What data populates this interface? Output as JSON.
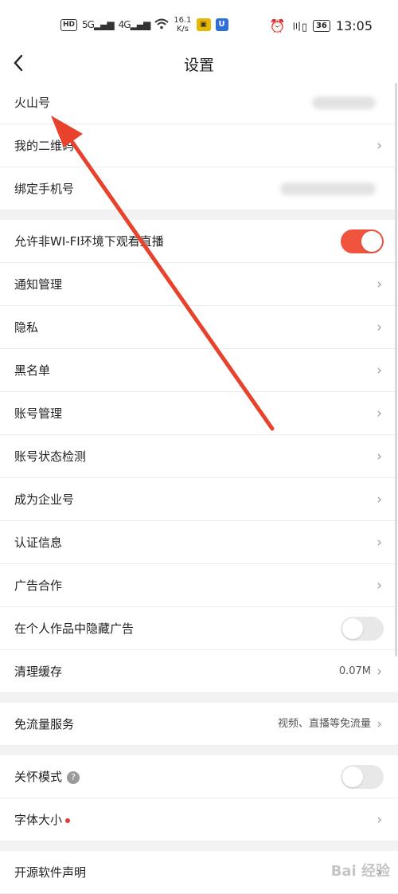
{
  "status_bar": {
    "hd": "HD",
    "sim1": "5G",
    "sim2": "4G",
    "speed_value": "16.1",
    "speed_unit": "K/s",
    "battery": "36",
    "time": "13:05"
  },
  "header": {
    "title": "设置"
  },
  "settings": {
    "huoshan_id": "火山号",
    "qr_code": "我的二维码",
    "bind_phone": "绑定手机号",
    "allow_non_wifi": "允许非WI-FI环境下观看直播",
    "allow_non_wifi_on": true,
    "notifications": "通知管理",
    "privacy": "隐私",
    "blacklist": "黑名单",
    "account_mgmt": "账号管理",
    "account_check": "账号状态检测",
    "enterprise": "成为企业号",
    "certification": "认证信息",
    "ad_coop": "广告合作",
    "hide_ads": "在个人作品中隐藏广告",
    "hide_ads_on": false,
    "clear_cache": "清理缓存",
    "cache_size": "0.07M",
    "free_data": "免流量服务",
    "free_data_desc": "视频、直播等免流量",
    "care_mode": "关怀模式",
    "care_mode_on": false,
    "font_size": "字体大小",
    "open_source": "开源软件声明"
  },
  "watermark": "Bai 经验",
  "colors": {
    "accent": "#f0543f",
    "arrow": "#e8412c"
  },
  "icons": {
    "back": "chevron-left-icon",
    "chevron": "chevron-right-icon",
    "help": "question-circle-icon"
  }
}
